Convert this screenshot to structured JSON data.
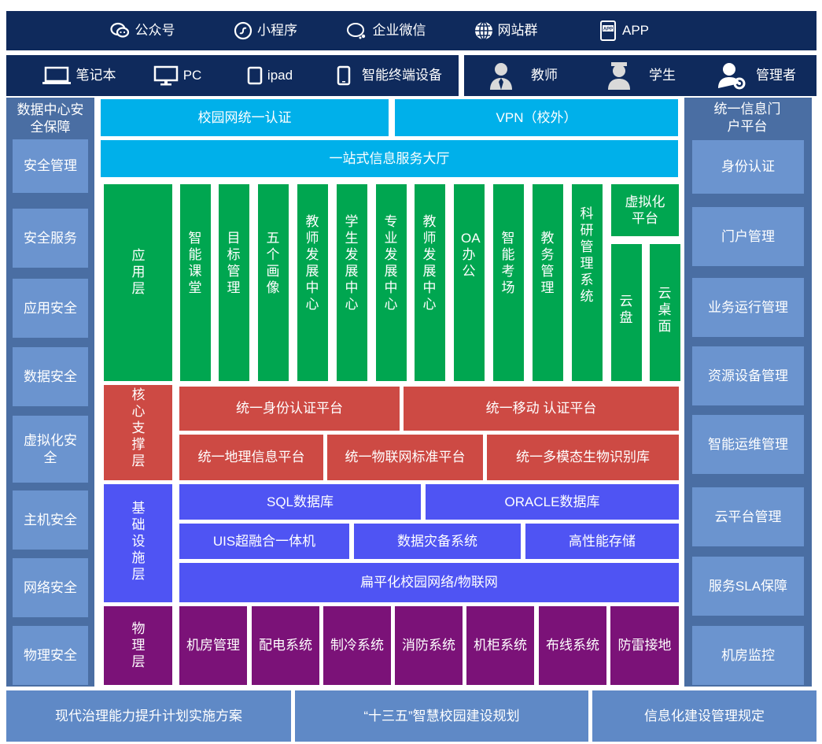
{
  "channels": [
    {
      "label": "公众号",
      "icon": "wechat-icon"
    },
    {
      "label": "小程序",
      "icon": "mini-program-icon"
    },
    {
      "label": "企业微信",
      "icon": "enterprise-wechat-icon"
    },
    {
      "label": "网站群",
      "icon": "globe-icon"
    },
    {
      "label": "APP",
      "icon": "app-icon"
    }
  ],
  "devices": [
    {
      "label": "笔记本",
      "icon": "laptop-icon"
    },
    {
      "label": "PC",
      "icon": "monitor-icon"
    },
    {
      "label": "ipad",
      "icon": "tablet-icon"
    },
    {
      "label": "智能终端设备",
      "icon": "phone-icon"
    }
  ],
  "users": [
    {
      "label": "教师",
      "icon": "teacher-icon"
    },
    {
      "label": "学生",
      "icon": "student-icon"
    },
    {
      "label": "管理者",
      "icon": "manager-icon"
    }
  ],
  "left": {
    "title": "数据中心安全保障",
    "items": [
      "安全管理",
      "安全服务",
      "应用安全",
      "数据安全",
      "虚拟化安全",
      "主机安全",
      "网络安全",
      "物理安全"
    ]
  },
  "right": {
    "title": "统一信息门户平台",
    "items": [
      "身份认证",
      "门户管理",
      "业务运行管理",
      "资源设备管理",
      "智能运维管理",
      "云平台管理",
      "服务SLA保障",
      "机房监控"
    ]
  },
  "access": {
    "auth": "校园网统一认证",
    "vpn": "VPN（校外）",
    "hall": "一站式信息服务大厅"
  },
  "app_layer": {
    "label": "应用层",
    "columns": [
      "智能课堂",
      "目标管理",
      "五个画像",
      "教师发展中心",
      "学生发展中心",
      "专业发展中心",
      "教师发展中心",
      "OA办公",
      "智能考场",
      "教务管理",
      "科研管理系统"
    ],
    "virtual": {
      "title": "虚拟化平台",
      "items": [
        "云盘",
        "云桌面"
      ]
    }
  },
  "core_layer": {
    "label": "核心支撑层",
    "row1": [
      "统一身份认证平台",
      "统一移动 认证平台"
    ],
    "row2": [
      "统一地理信息平台",
      "统一物联网标准平台",
      "统一多模态生物识别库"
    ]
  },
  "infra_layer": {
    "label": "基础设施层",
    "row1": [
      "SQL数据库",
      "ORACLE数据库"
    ],
    "row2": [
      "UIS超融合一体机",
      "数据灾备系统",
      "高性能存储"
    ],
    "row3": [
      "扁平化校园网络/物联网"
    ]
  },
  "phys_layer": {
    "label": "物理层",
    "items": [
      "机房管理",
      "配电系统",
      "制冷系统",
      "消防系统",
      "机柜系统",
      "布线系统",
      "防雷接地"
    ]
  },
  "footer": [
    "现代治理能力提升计划实施方案",
    "“十三五”智慧校园建设规划",
    "信息化建设管理规定"
  ],
  "colors": {
    "navy": "#0f2a5c",
    "access_blue": "#00b0ea",
    "app_green": "#00a650",
    "core_red": "#cd4a44",
    "infra_indigo": "#4f54f3",
    "phys_purple": "#7b1278",
    "side_tile": "#6b94cf"
  }
}
